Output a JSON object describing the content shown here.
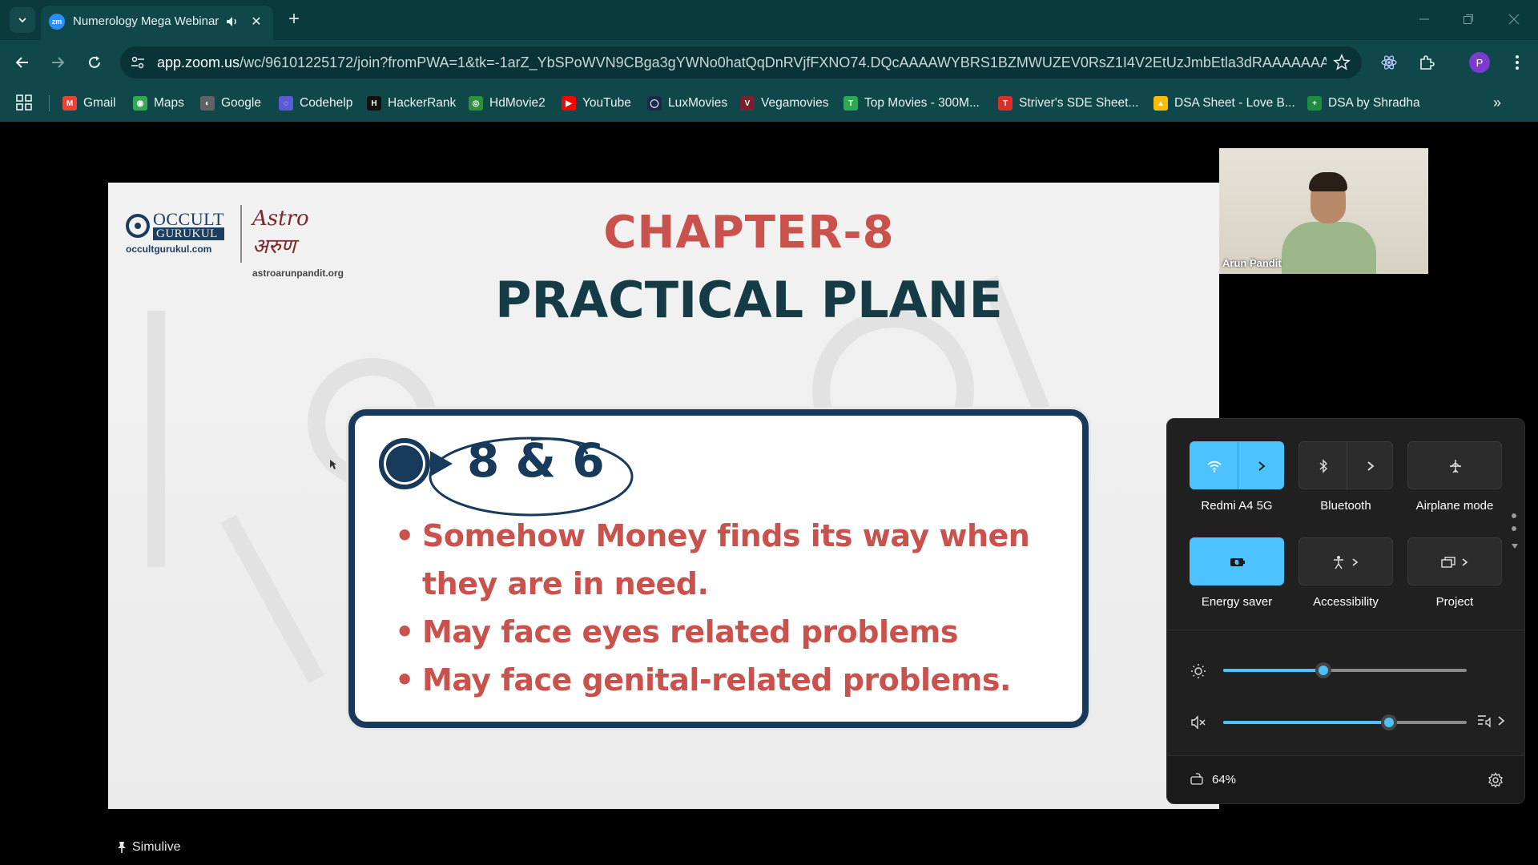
{
  "browser": {
    "tab_title": "Numerology Mega Webinar",
    "url_host": "app.zoom.us",
    "url_path": "/wc/96101225172/join?fromPWA=1&tk=-1arZ_YbSPoWVN9CBga3gYWNo0hatQqDnRVjfFXNO74.DQcAAAAWYBRS1BZMWUZEV0RsZ1I4V2EtUzJmbEtla3dRAAAAAAAAAAAA...",
    "profile_initial": "P",
    "bookmarks": [
      {
        "label": "Gmail",
        "icon": "gmail-icon",
        "color": "#ea4335",
        "glyph": "M"
      },
      {
        "label": "Maps",
        "icon": "maps-icon",
        "color": "#34a853",
        "glyph": "◉"
      },
      {
        "label": "Google",
        "icon": "globe-icon",
        "color": "#5f6368",
        "glyph": "◐"
      },
      {
        "label": "Codehelp",
        "icon": "codehelp-icon",
        "color": "#5b5bd6",
        "glyph": "◌"
      },
      {
        "label": "HackerRank",
        "icon": "hackerrank-icon",
        "color": "#111111",
        "glyph": "H"
      },
      {
        "label": "HdMovie2",
        "icon": "hdmovie-icon",
        "color": "#2f8f3a",
        "glyph": "◎"
      },
      {
        "label": "YouTube",
        "icon": "youtube-icon",
        "color": "#ff0000",
        "glyph": "▶"
      },
      {
        "label": "LuxMovies",
        "icon": "luxmovies-icon",
        "color": "#1a2a4a",
        "glyph": "◯"
      },
      {
        "label": "Vegamovies",
        "icon": "vegamovies-icon",
        "color": "#7a1f2f",
        "glyph": "V"
      },
      {
        "label": "Top Movies - 300M...",
        "icon": "topmovies-icon",
        "color": "#2fa84f",
        "glyph": "T"
      },
      {
        "label": "Striver's SDE Sheet...",
        "icon": "striver-icon",
        "color": "#d93025",
        "glyph": "T"
      },
      {
        "label": "DSA Sheet - Love B...",
        "icon": "drive-icon",
        "color": "#fbbc04",
        "glyph": "▲"
      },
      {
        "label": "DSA by Shradha",
        "icon": "sheets-icon",
        "color": "#1e8e3e",
        "glyph": "+"
      }
    ]
  },
  "slide": {
    "logo_left_name": "OCCULT",
    "logo_left_sub": "GURUKUL",
    "logo_left_site": "occultgurukul.com",
    "logo_right_mark": "Astro अरुण",
    "logo_right_site": "astroarunpandit.org",
    "chapter": "CHAPTER-8",
    "heading": "PRACTICAL PLANE",
    "numbers": "8 & 6",
    "points": [
      "Somehow Money finds its way when they are in need.",
      "May face eyes related problems",
      "May face genital-related problems."
    ]
  },
  "video": {
    "participant_name": "Arun Pandit"
  },
  "footer": {
    "simulive_label": "Simulive"
  },
  "quick_settings": {
    "tiles": [
      {
        "label": "Redmi A4 5G",
        "icon": "wifi-icon",
        "active": true,
        "split": true
      },
      {
        "label": "Bluetooth",
        "icon": "bluetooth-icon",
        "active": false,
        "split": true
      },
      {
        "label": "Airplane mode",
        "icon": "airplane-icon",
        "active": false,
        "split": false
      },
      {
        "label": "Energy saver",
        "icon": "energy-saver-icon",
        "active": true,
        "split": false
      },
      {
        "label": "Accessibility",
        "icon": "accessibility-icon",
        "active": false,
        "split": false
      },
      {
        "label": "Project",
        "icon": "project-icon",
        "active": false,
        "split": false
      }
    ],
    "brightness_level": 0.41,
    "volume_level": 0.68,
    "volume_muted": true,
    "battery_percent": "64%",
    "accent_color": "#4cc2ff"
  }
}
